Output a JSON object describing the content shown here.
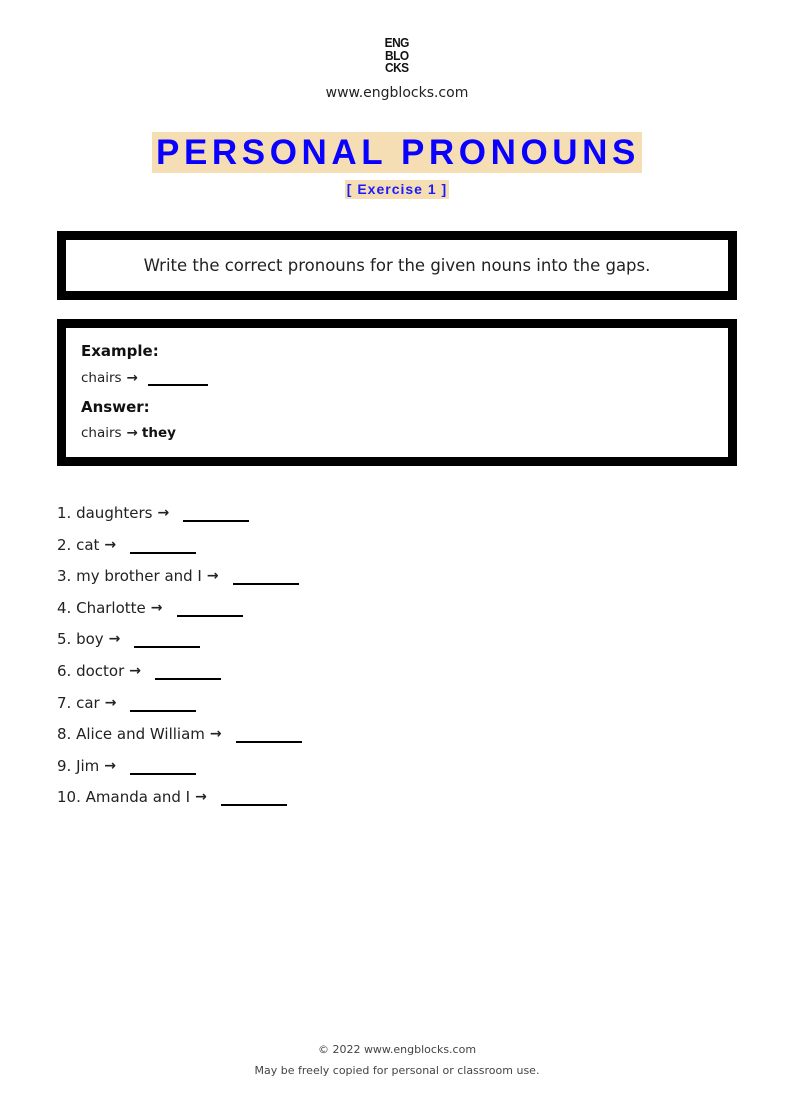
{
  "header": {
    "logo_lines": [
      "ENG",
      "BLO",
      "CKS"
    ],
    "site_url": "www.engblocks.com",
    "title": "PERSONAL PRONOUNS",
    "subtitle": "[ Exercise 1 ]",
    "accent_color": "#0a00ff",
    "highlight_color": "#f5deb3"
  },
  "instructions": "Write the correct pronouns for the given nouns into the gaps.",
  "example": {
    "example_label": "Example:",
    "example_word": "chairs",
    "answer_label": "Answer:",
    "answer_word": "chairs",
    "answer_value": "they",
    "arrow_icon": "→"
  },
  "exercise": {
    "arrow_icon": "→",
    "items": [
      {
        "number": "1.",
        "word": "daughters"
      },
      {
        "number": "2.",
        "word": "cat"
      },
      {
        "number": "3.",
        "word": "my brother and I"
      },
      {
        "number": "4.",
        "word": "Charlotte"
      },
      {
        "number": "5.",
        "word": "boy"
      },
      {
        "number": "6.",
        "word": "doctor"
      },
      {
        "number": "7.",
        "word": "car"
      },
      {
        "number": "8.",
        "word": "Alice and William"
      },
      {
        "number": "9.",
        "word": "Jim"
      },
      {
        "number": "10.",
        "word": "Amanda and I"
      }
    ]
  },
  "footer": {
    "copyright": "© 2022 www.engblocks.com",
    "license": "May be freely copied for personal or classroom use."
  }
}
